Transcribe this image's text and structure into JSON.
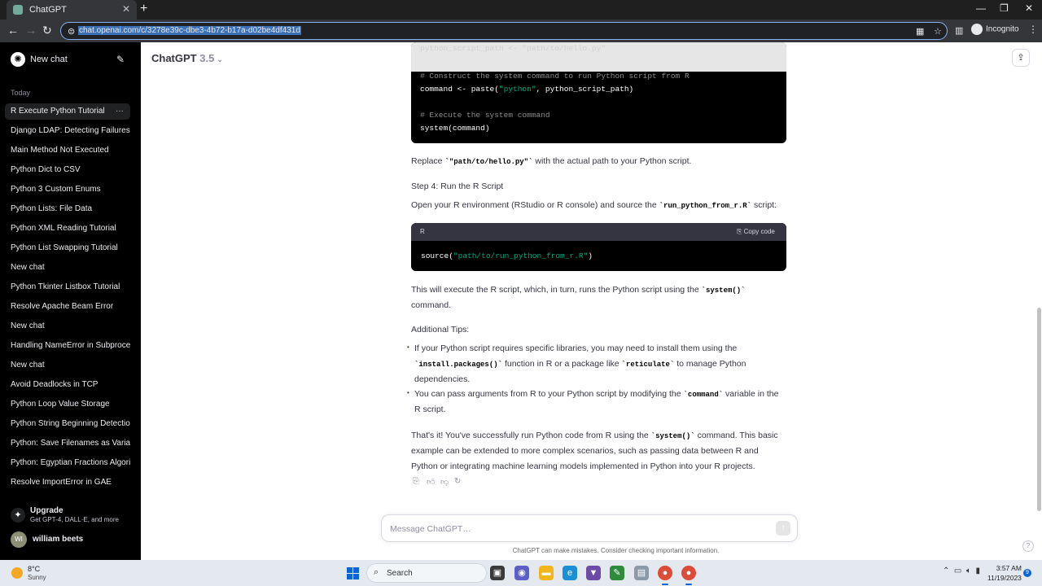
{
  "browser": {
    "tab_title": "ChatGPT",
    "close_tab": "✕",
    "new_tab": "+",
    "url": "chat.openai.com/c/3278e39c-dbe3-4b72-b17a-d02be4df431d",
    "incognito_label": "Incognito",
    "window_minimize": "—",
    "window_restore": "❐",
    "window_close": "✕"
  },
  "sidebar": {
    "new_chat_label": "New chat",
    "section_today": "Today",
    "items": [
      {
        "label": "R Execute Python Tutorial",
        "active": true
      },
      {
        "label": "Django LDAP: Detecting Failures"
      },
      {
        "label": "Main Method Not Executed"
      },
      {
        "label": "Python Dict to CSV"
      },
      {
        "label": "Python 3 Custom Enums"
      },
      {
        "label": "Python Lists: File Data"
      },
      {
        "label": "Python XML Reading Tutorial"
      },
      {
        "label": "Python List Swapping Tutorial"
      },
      {
        "label": "New chat"
      },
      {
        "label": "Python Tkinter Listbox Tutorial"
      },
      {
        "label": "Resolve Apache Beam Error"
      },
      {
        "label": "New chat"
      },
      {
        "label": "Handling NameError in Subprocess"
      },
      {
        "label": "New chat"
      },
      {
        "label": "Avoid Deadlocks in TCP"
      },
      {
        "label": "Python Loop Value Storage"
      },
      {
        "label": "Python String Beginning Detection"
      },
      {
        "label": "Python: Save Filenames as Variables"
      },
      {
        "label": "Python: Egyptian Fractions Algorithm"
      },
      {
        "label": "Resolve ImportError in GAE"
      }
    ],
    "upgrade_title": "Upgrade",
    "upgrade_subtitle": "Get GPT-4, DALL·E, and more",
    "user_initials": "WI",
    "user_name": "william beets"
  },
  "header": {
    "model_name": "ChatGPT",
    "model_version": "3.5"
  },
  "message": {
    "code1_faded": "python_script_path <- \"path/to/hello.py\"",
    "code1_comment1": "# Construct the system command to run Python script from R",
    "code1_line2a": "command <- paste(",
    "code1_line2_str": "\"python\"",
    "code1_line2b": ", python_script_path)",
    "code1_comment2": "# Execute the system command",
    "code1_line3": "system(command)",
    "replace_pre": "Replace ",
    "replace_code": "`\"path/to/hello.py\"`",
    "replace_post": " with the actual path to your Python script.",
    "step4": "Step 4: Run the R Script",
    "open_pre": "Open your R environment (RStudio or R console) and source the ",
    "open_code": "`run_python_from_r.R`",
    "open_post": " script:",
    "code2_lang": "R",
    "code2_copy": "Copy code",
    "code2_fn": "source(",
    "code2_str": "\"path/to/run_python_from_r.R\"",
    "code2_end": ")",
    "exec_pre": "This will execute the R script, which, in turn, runs the Python script using the ",
    "exec_code": "`system()`",
    "exec_post": "command.",
    "tips_title": "Additional Tips:",
    "tip1_line1": "If your Python script requires specific libraries, you may need to install them using the",
    "tip1_code1": "`install.packages()`",
    "tip1_mid": " function in R or a package like ",
    "tip1_code2": "`reticulate`",
    "tip1_post": " to manage Python",
    "tip1_line3": "dependencies.",
    "tip2_pre": "You can pass arguments from R to your Python script by modifying the ",
    "tip2_code": "`command`",
    "tip2_post": " variable in the",
    "tip2_line2": "R script.",
    "final_pre": "That's it! You've successfully run Python code from R using the ",
    "final_code": "`system()`",
    "final_post": " command. This basic",
    "final_line2": "example can be extended to more complex scenarios, such as passing data between R and",
    "final_line3": "Python or integrating machine learning models implemented in Python into your R projects."
  },
  "composer": {
    "placeholder": "Message ChatGPT…",
    "disclaimer": "ChatGPT can make mistakes. Consider checking important information.",
    "help": "?"
  },
  "taskbar": {
    "temperature": "8°C",
    "condition": "Sunny",
    "search_label": "Search",
    "time": "3:57 AM",
    "date": "11/19/2023",
    "notification_count": "9"
  },
  "icons": [
    "chatgpt-logo-icon",
    "edit-icon",
    "more-dots-icon",
    "upgrade-sparkle-icon",
    "share-icon",
    "copy-icon",
    "thumbs-up-icon",
    "thumbs-down-icon",
    "regenerate-icon",
    "send-arrow-icon",
    "windows-start-icon",
    "search-icon"
  ]
}
